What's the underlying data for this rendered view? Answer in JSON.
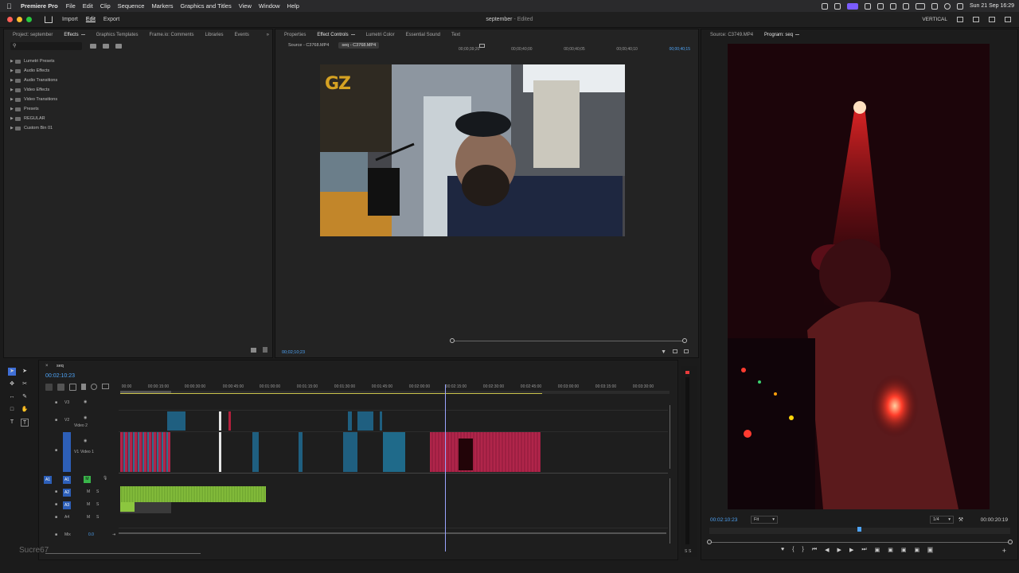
{
  "menubar": {
    "app": "Premiere Pro",
    "items": [
      "File",
      "Edit",
      "Clip",
      "Sequence",
      "Markers",
      "Graphics and Titles",
      "View",
      "Window",
      "Help"
    ],
    "clock": "Sun 21 Sep 16:29"
  },
  "appbar": {
    "workspaces": [
      "Import",
      "Edit",
      "Export"
    ],
    "active_workspace": "Edit",
    "doc_title": "september",
    "doc_status": "- Edited",
    "layout_label": "VERTICAL"
  },
  "effects_panel": {
    "tabs": [
      "Project: september",
      "Effects",
      "Graphics Templates",
      "Frame.io: Comments",
      "Libraries",
      "Events"
    ],
    "active_tab": "Effects",
    "items": [
      "Lumetri Presets",
      "Audio Effects",
      "Audio Transitions",
      "Video Effects",
      "Video Transitions",
      "Presets",
      "REGULAR",
      "Custom Bin 01"
    ]
  },
  "source_panel": {
    "tabs": [
      "Properties",
      "Effect Controls",
      "Lumetri Color",
      "Essential Sound",
      "Text"
    ],
    "active_tab": "Effect Controls",
    "subtabs": [
      "Source - C3768.MP4",
      "seq - C3768.MP4"
    ],
    "ruler": [
      "00;00;39;20",
      "00;00;40;00",
      "00;00;40;05",
      "00;00;40;10",
      "00;00;40;15"
    ],
    "timecode": "00;02;10;23",
    "video_overlay_text": "GZ"
  },
  "program_panel": {
    "tabs": [
      "Source: C3749.MP4",
      "Program: seq"
    ],
    "active_tab": "Program: seq",
    "timecode": "00:02:10:23",
    "fit": "Fit",
    "resolution": "1/4",
    "duration": "00:00:20:19"
  },
  "timeline": {
    "sequence": "seq",
    "timecode": "00:02:10:23",
    "ruler_labels": [
      "00:00",
      "00:00:15:00",
      "00:00:30:00",
      "00:00:45:00",
      "00:01:00:00",
      "00:01:15:00",
      "00:01:30:00",
      "00:01:45:00",
      "00:02:00:00",
      "00:02:15:00",
      "00:02:30:00",
      "00:02:45:00",
      "00:03:00:00",
      "00:03:15:00",
      "00:03:30:00"
    ],
    "video_tracks": [
      {
        "id": "V3",
        "name": ""
      },
      {
        "id": "V2",
        "name": "Video 2"
      },
      {
        "id": "V1",
        "name": "Video 1"
      }
    ],
    "audio_tracks": [
      {
        "id": "A1"
      },
      {
        "id": "A2"
      },
      {
        "id": "A3"
      },
      {
        "id": "A4"
      }
    ],
    "mix_label": "Mix",
    "mix_value": "0.0",
    "meter_labels": [
      "S",
      "S"
    ]
  },
  "watermark": "Sucre67"
}
